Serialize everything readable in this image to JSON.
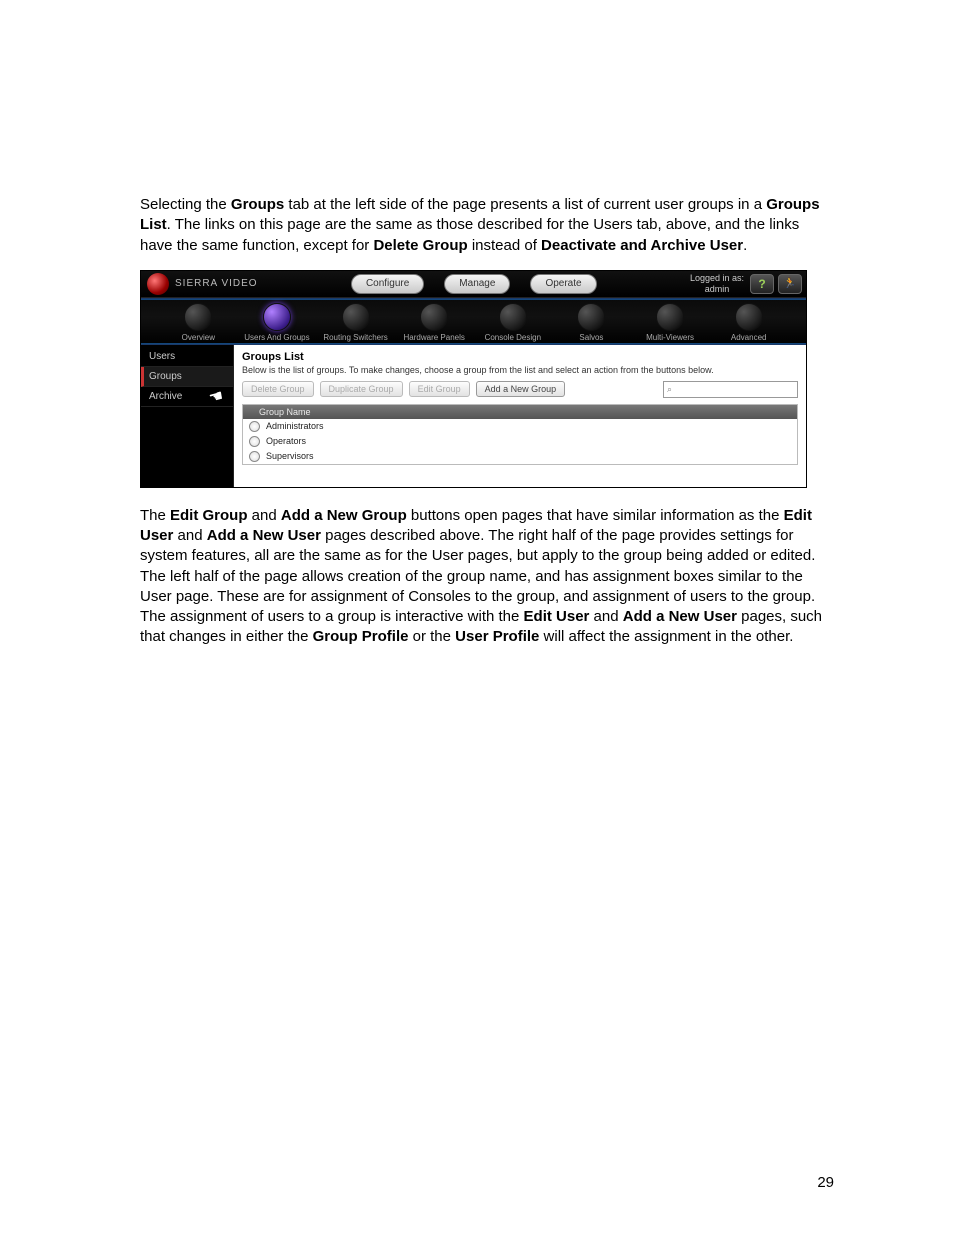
{
  "para1": {
    "seg1": "Selecting the ",
    "b1": "Groups",
    "seg2": " tab at the left side of the page presents a list of current user groups in a ",
    "b2": "Groups List",
    "seg3": ". The links on this page are the same as those described for the Users tab, above, and the links have the same function, except for ",
    "b3": "Delete Group",
    "seg4": " instead of ",
    "b4": "Deactivate and Archive User",
    "seg5": "."
  },
  "app": {
    "brand": "SIERRA VIDEO",
    "topnav": [
      "Configure",
      "Manage",
      "Operate"
    ],
    "logged_label": "Logged in as:",
    "logged_user": "admin",
    "help": "?",
    "exit": "✕",
    "subnav": [
      "Overview",
      "Users And Groups",
      "Routing Switchers",
      "Hardware Panels",
      "Console Design",
      "Salvos",
      "Multi-Viewers",
      "Advanced"
    ],
    "subnav_active_index": 1,
    "sidebar": [
      "Users",
      "Groups",
      "Archive"
    ],
    "sidebar_active_index": 1,
    "main": {
      "title": "Groups List",
      "desc": "Below is the list of groups. To make changes, choose a group from the list and select an action from the buttons below.",
      "buttons": {
        "delete": "Delete Group",
        "duplicate": "Duplicate Group",
        "edit": "Edit Group",
        "add": "Add a New Group"
      },
      "search_icon": "⌕",
      "col_header": "Group Name",
      "rows": [
        "Administrators",
        "Operators",
        "Supervisors"
      ]
    }
  },
  "para2": {
    "seg1": "The ",
    "b1": "Edit Group",
    "seg2": " and ",
    "b2": "Add a New Group",
    "seg3": " buttons open pages that have similar information as the ",
    "b3": "Edit User",
    "seg4": " and ",
    "b4": "Add a New User",
    "seg5": " pages described above. The right half of the page provides settings for system features, all are the same as for the User pages, but apply to the group being added or edited. The left half of the page allows creation of the group name, and has assignment boxes similar to the User page. These are for assignment of Consoles to the group, and assignment of users to the group. The assignment of users to a group is interactive with the ",
    "b5": "Edit User",
    "seg6": " and ",
    "b6": "Add a New User",
    "seg7": " pages, such that changes in either the ",
    "b7": "Group Profile",
    "seg8": " or the ",
    "b8": "User Profile",
    "seg9": " will affect the assignment in the other."
  },
  "pagenum": "29"
}
